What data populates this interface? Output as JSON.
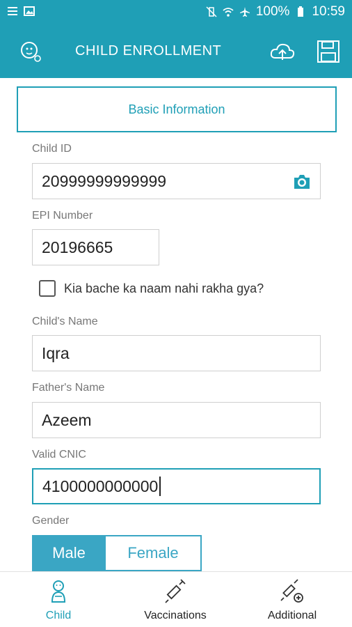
{
  "statusbar": {
    "battery": "100%",
    "time": "10:59"
  },
  "appbar": {
    "title": "CHILD ENROLLMENT"
  },
  "section": {
    "title": "Basic Information"
  },
  "form": {
    "child_id": {
      "label": "Child ID",
      "value": "20999999999999"
    },
    "epi_number": {
      "label": "EPI Number",
      "value": "20196665"
    },
    "no_name_checkbox": {
      "label": "Kia bache ka naam nahi rakha gya?",
      "checked": false
    },
    "child_name": {
      "label": "Child's Name",
      "value": "Iqra"
    },
    "father_name": {
      "label": "Father's Name",
      "value": "Azeem"
    },
    "cnic": {
      "label": "Valid CNIC",
      "value": "4100000000000"
    },
    "gender": {
      "label": "Gender",
      "options": [
        "Male",
        "Female"
      ],
      "selected": "Male"
    }
  },
  "bottom_nav": {
    "items": [
      {
        "label": "Child",
        "icon": "baby-icon",
        "active": true
      },
      {
        "label": "Vaccinations",
        "icon": "syringe-icon",
        "active": false
      },
      {
        "label": "Additional",
        "icon": "syringe-plus-icon",
        "active": false
      }
    ]
  },
  "colors": {
    "primary": "#1f9fb6",
    "segment": "#3aa6c4"
  }
}
